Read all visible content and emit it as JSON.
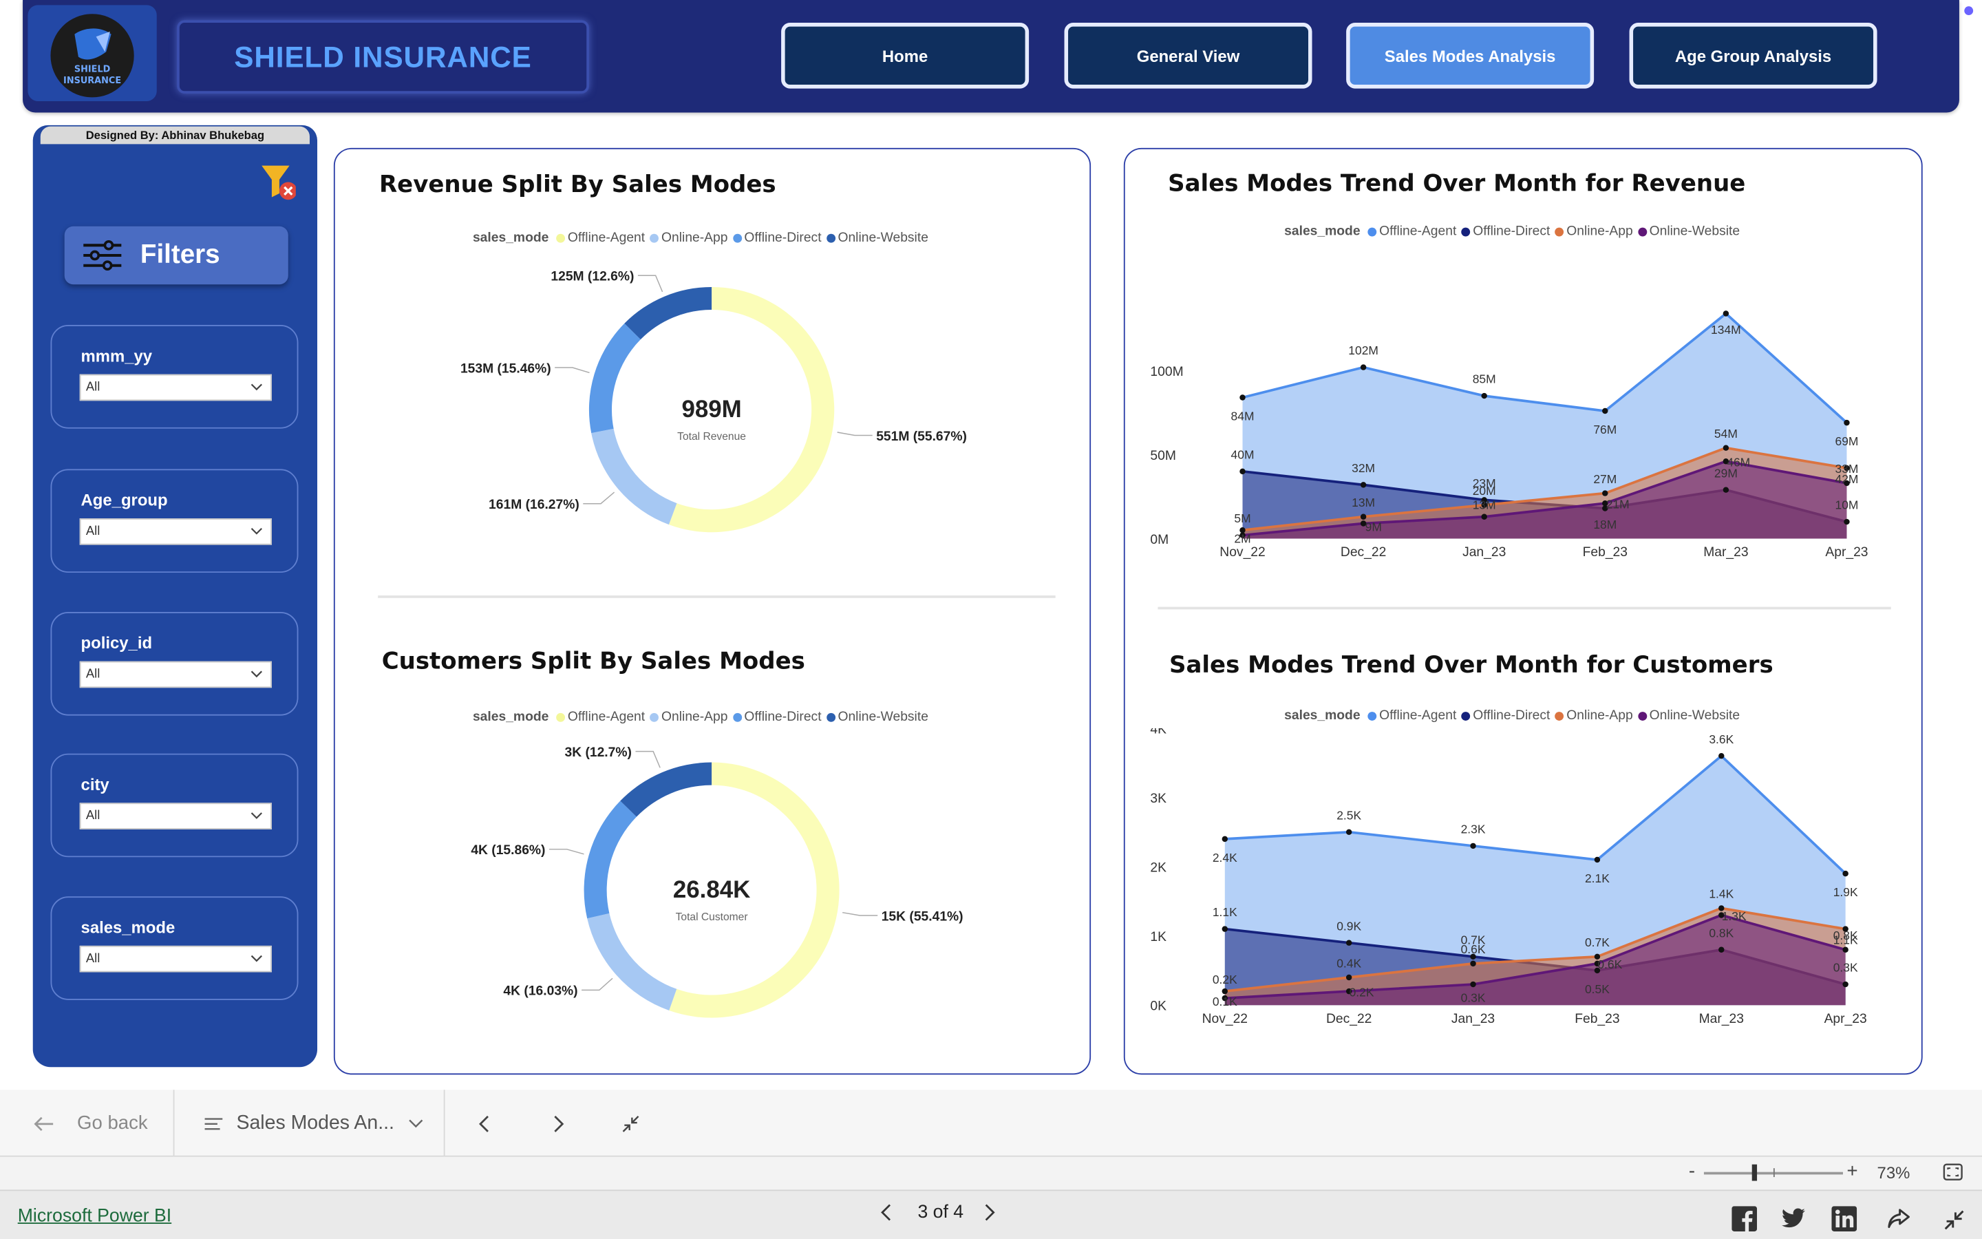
{
  "header": {
    "logo_text": [
      "SHIELD",
      "INSURANCE"
    ],
    "title": "SHIELD INSURANCE",
    "nav": [
      {
        "label": "Home",
        "active": false
      },
      {
        "label": "General View",
        "active": false
      },
      {
        "label": "Sales Modes Analysis",
        "active": true
      },
      {
        "label": "Age Group Analysis",
        "active": false
      }
    ]
  },
  "sidebar": {
    "designed_by": "Designed By: Abhinav Bhukebag",
    "filters_label": "Filters",
    "slicers": [
      {
        "title": "mmm_yy",
        "value": "All"
      },
      {
        "title": "Age_group",
        "value": "All"
      },
      {
        "title": "policy_id",
        "value": "All"
      },
      {
        "title": "city",
        "value": "All"
      },
      {
        "title": "sales_mode",
        "value": "All"
      }
    ]
  },
  "legend_title": "sales_mode",
  "colors": {
    "donut": {
      "Offline-Agent": "#fbfdb8",
      "Online-App": "#a6c8f3",
      "Offline-Direct": "#5b9ae8",
      "Online-Website": "#2c5fae"
    },
    "trend": {
      "Offline-Agent": "#4d8eed",
      "Offline-Direct": "#15217c",
      "Online-App": "#db7440",
      "Online-Website": "#5f1777"
    }
  },
  "chart_data": [
    {
      "type": "pie",
      "title": "Revenue Split By Sales Modes",
      "legend": [
        "Offline-Agent",
        "Online-App",
        "Offline-Direct",
        "Online-Website"
      ],
      "center_value": "989M",
      "center_label": "Total Revenue",
      "slices": [
        {
          "name": "Offline-Agent",
          "percent": 55.67,
          "label": "551M (55.67%)"
        },
        {
          "name": "Online-App",
          "percent": 16.27,
          "label": "161M (16.27%)"
        },
        {
          "name": "Offline-Direct",
          "percent": 15.46,
          "label": "153M (15.46%)"
        },
        {
          "name": "Online-Website",
          "percent": 12.6,
          "label": "125M (12.6%)"
        }
      ]
    },
    {
      "type": "pie",
      "title": "Customers Split By Sales Modes",
      "legend": [
        "Offline-Agent",
        "Online-App",
        "Offline-Direct",
        "Online-Website"
      ],
      "center_value": "26.84K",
      "center_label": "Total Customer",
      "slices": [
        {
          "name": "Offline-Agent",
          "percent": 55.41,
          "label": "15K (55.41%)"
        },
        {
          "name": "Online-App",
          "percent": 16.03,
          "label": "4K (16.03%)"
        },
        {
          "name": "Offline-Direct",
          "percent": 15.86,
          "label": "4K (15.86%)"
        },
        {
          "name": "Online-Website",
          "percent": 12.7,
          "label": "3K (12.7%)"
        }
      ]
    },
    {
      "type": "area",
      "title": "Sales Modes Trend Over Month for Revenue",
      "legend": [
        "Offline-Agent",
        "Offline-Direct",
        "Online-App",
        "Online-Website"
      ],
      "categories": [
        "Nov_22",
        "Dec_22",
        "Jan_23",
        "Feb_23",
        "Mar_23",
        "Apr_23"
      ],
      "y_ticks": [
        {
          "v": 0,
          "t": "0M"
        },
        {
          "v": 50,
          "t": "50M"
        },
        {
          "v": 100,
          "t": "100M"
        }
      ],
      "ylim": [
        0,
        134
      ],
      "series": [
        {
          "name": "Offline-Agent",
          "values": [
            84,
            102,
            85,
            76,
            134,
            69
          ],
          "labels": [
            "84M",
            "102M",
            "85M",
            "76M",
            "134M",
            "69M"
          ]
        },
        {
          "name": "Offline-Direct",
          "values": [
            40,
            32,
            23,
            18,
            29,
            10
          ],
          "labels": [
            "40M",
            "32M",
            "23M",
            "18M",
            "29M",
            "10M"
          ]
        },
        {
          "name": "Online-App",
          "values": [
            5,
            13,
            20,
            27,
            54,
            42
          ],
          "labels": [
            "5M",
            "13M",
            "20M",
            "27M",
            "54M",
            "42M"
          ]
        },
        {
          "name": "Online-Website",
          "values": [
            2,
            9,
            13,
            21,
            46,
            33
          ],
          "labels": [
            "2M",
            "9M",
            "13M",
            "21M",
            "46M",
            "33M"
          ]
        }
      ]
    },
    {
      "type": "area",
      "title": "Sales Modes Trend Over Month for Customers",
      "legend": [
        "Offline-Agent",
        "Offline-Direct",
        "Online-App",
        "Online-Website"
      ],
      "categories": [
        "Nov_22",
        "Dec_22",
        "Jan_23",
        "Feb_23",
        "Mar_23",
        "Apr_23"
      ],
      "y_ticks": [
        {
          "v": 0,
          "t": "0K"
        },
        {
          "v": 1,
          "t": "1K"
        },
        {
          "v": 2,
          "t": "2K"
        },
        {
          "v": 3,
          "t": "3K"
        },
        {
          "v": 4,
          "t": "4K"
        }
      ],
      "ylim": [
        0,
        4
      ],
      "series": [
        {
          "name": "Offline-Agent",
          "values": [
            2.4,
            2.5,
            2.3,
            2.1,
            3.6,
            1.9
          ],
          "labels": [
            "2.4K",
            "2.5K",
            "2.3K",
            "2.1K",
            "3.6K",
            "1.9K"
          ]
        },
        {
          "name": "Offline-Direct",
          "values": [
            1.1,
            0.9,
            0.7,
            0.5,
            0.8,
            0.3
          ],
          "labels": [
            "1.1K",
            "0.9K",
            "0.7K",
            "0.5K",
            "0.8K",
            "0.3K"
          ]
        },
        {
          "name": "Online-App",
          "values": [
            0.2,
            0.4,
            0.6,
            0.7,
            1.4,
            1.1
          ],
          "labels": [
            "0.2K",
            "0.4K",
            "0.6K",
            "0.7K",
            "1.4K",
            "1.1K"
          ]
        },
        {
          "name": "Online-Website",
          "values": [
            0.1,
            0.2,
            0.3,
            0.6,
            1.3,
            0.8
          ],
          "labels": [
            "0.1K",
            "0.2K",
            "0.3K",
            "0.6K",
            "1.3K",
            "0.8K"
          ]
        }
      ]
    }
  ],
  "bottom_nav": {
    "go_back": "Go back",
    "page_menu": "Sales Modes An..."
  },
  "zoom": {
    "minus": "-",
    "plus": "+",
    "level": "73%",
    "value_percent": 73
  },
  "footer": {
    "brand": "Microsoft Power BI",
    "page_indicator": "3 of 4"
  }
}
